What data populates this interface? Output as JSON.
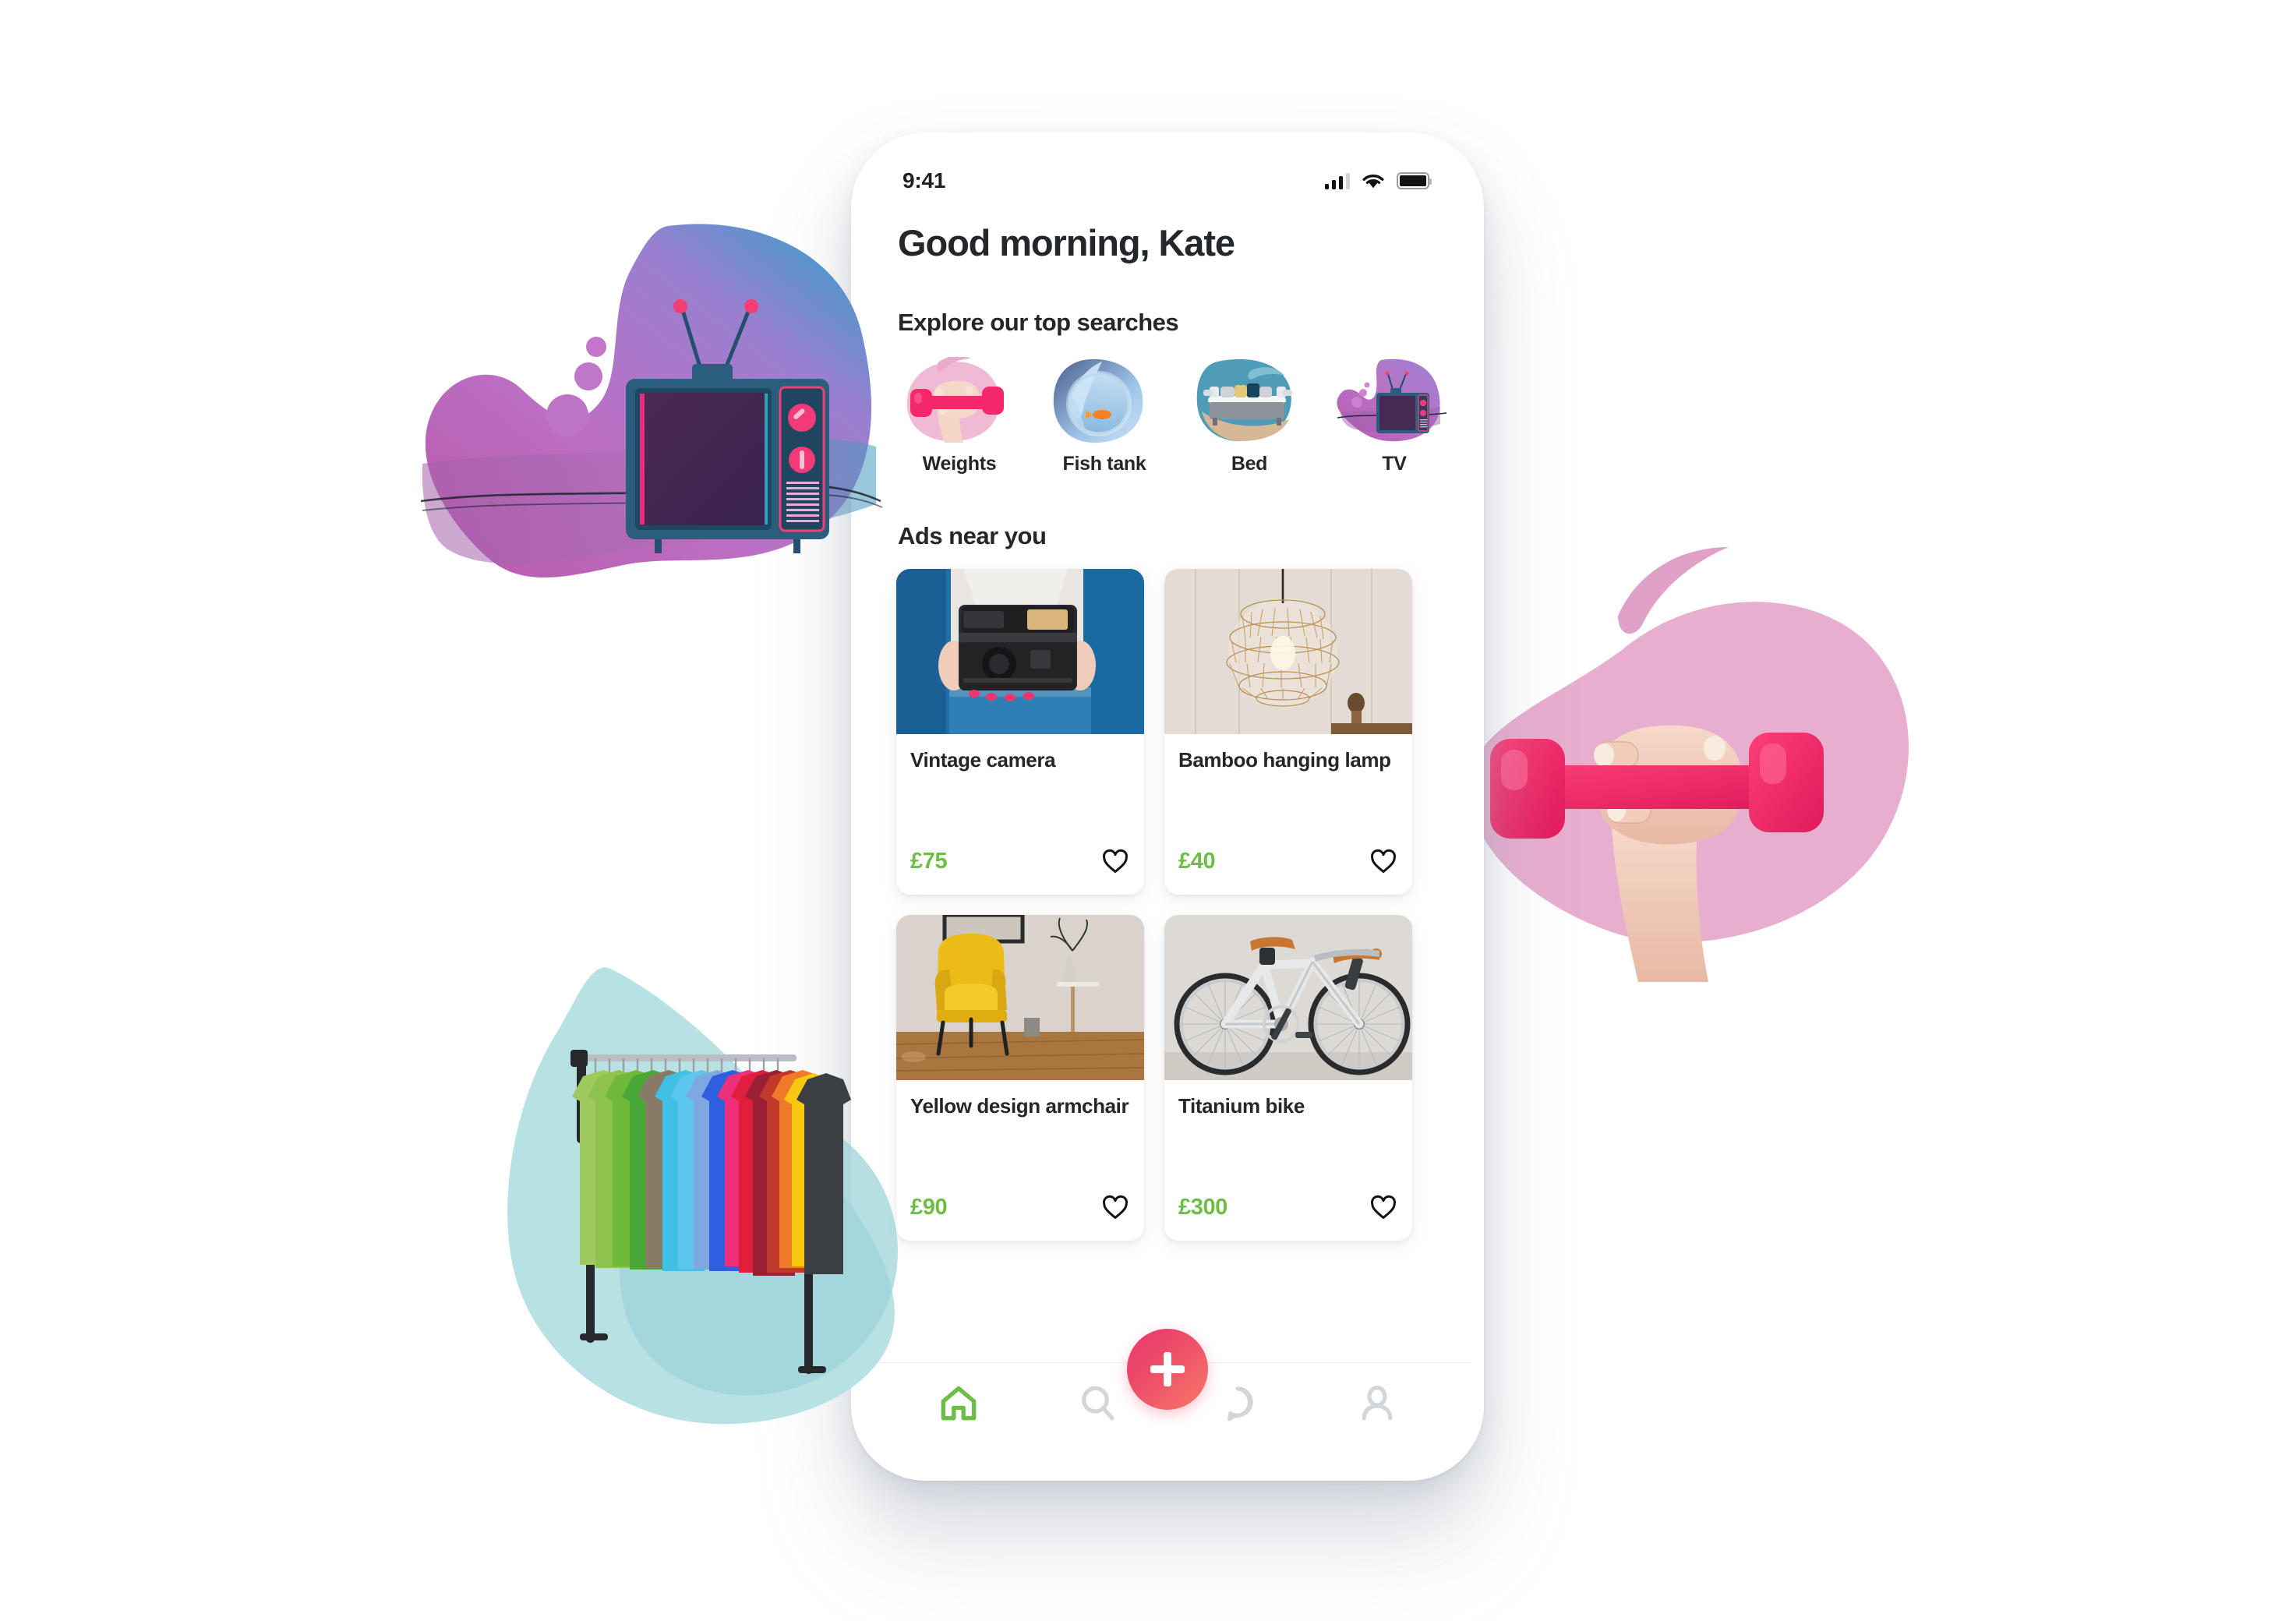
{
  "app": {
    "theme": {
      "price_green": "#6CBE45",
      "fab_gradient_start": "#E8356D",
      "fab_gradient_end": "#F7786A",
      "text_dark": "#23262A",
      "nav_active": "#6CBE45",
      "nav_inactive": "#D2D6D9"
    }
  },
  "status_bar": {
    "time": "9:41",
    "signal_icon": "signal-bars-icon",
    "wifi_icon": "wifi-icon",
    "battery_icon": "battery-full-icon"
  },
  "header": {
    "greeting": "Good morning, Kate"
  },
  "top_searches": {
    "heading": "Explore our top searches",
    "items": [
      {
        "label": "Weights",
        "icon": "weights-thumbnail"
      },
      {
        "label": "Fish tank",
        "icon": "fish-tank-thumbnail"
      },
      {
        "label": "Bed",
        "icon": "bed-thumbnail"
      },
      {
        "label": "TV",
        "icon": "tv-thumbnail"
      }
    ]
  },
  "ads": {
    "heading": "Ads near you",
    "items": [
      {
        "title": "Vintage camera",
        "price": "£75",
        "image": "vintage-camera-photo",
        "favourite_icon": "heart-outline-icon"
      },
      {
        "title": "Bamboo hanging lamp",
        "price": "£40",
        "image": "bamboo-lamp-photo",
        "favourite_icon": "heart-outline-icon"
      },
      {
        "title": "Yellow design armchair",
        "price": "£90",
        "image": "yellow-armchair-photo",
        "favourite_icon": "heart-outline-icon"
      },
      {
        "title": "Titanium bike",
        "price": "£300",
        "image": "titanium-bike-photo",
        "favourite_icon": "heart-outline-icon"
      }
    ]
  },
  "bottom_nav": {
    "items": [
      {
        "name": "home",
        "icon": "home-icon",
        "active": true
      },
      {
        "name": "search",
        "icon": "search-icon",
        "active": false
      },
      {
        "name": "messages",
        "icon": "chat-bubble-icon",
        "active": false
      },
      {
        "name": "profile",
        "icon": "person-icon",
        "active": false
      }
    ],
    "fab": {
      "icon": "plus-icon",
      "label": ""
    }
  },
  "decorations": [
    {
      "name": "tv-illustration",
      "description": "retro TV on purple blob"
    },
    {
      "name": "dumbbell-illustration",
      "description": "hand holding pink dumbbell on pink blob"
    },
    {
      "name": "clothes-rack-illustration",
      "description": "colourful t-shirts on rack over teal blob"
    }
  ]
}
